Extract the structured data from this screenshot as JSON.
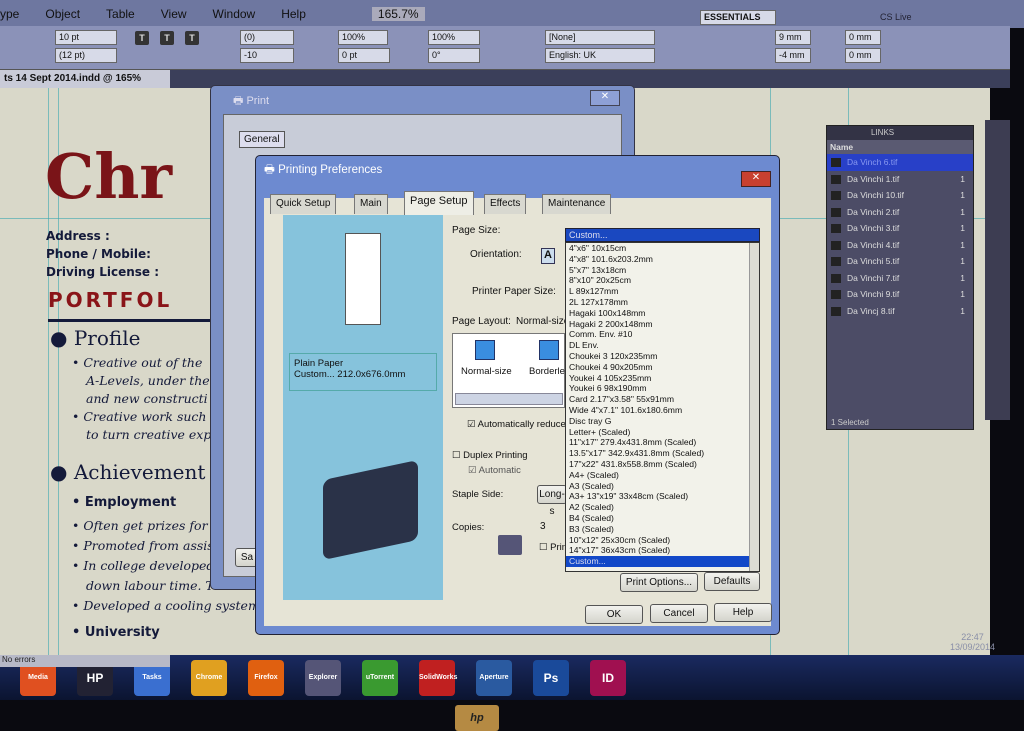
{
  "menu": [
    "ype",
    "Object",
    "Table",
    "View",
    "Window",
    "Help"
  ],
  "zoom": "165.7%",
  "control": {
    "font_size": "10 pt",
    "leading": "(12 pt)",
    "kerning": "(0)",
    "tracking": "-10",
    "vscale": "100%",
    "baseline": "0 pt",
    "hscale": "100%",
    "skew": "0°",
    "char_style": "[None]",
    "language": "English: UK",
    "left_indent": "9 mm",
    "first_indent": "-4 mm",
    "space_before": "0 mm",
    "space_after": "0 mm"
  },
  "workspace": "ESSENTIALS",
  "cs_live": "CS Live",
  "document_tab": "ts 14 Sept 2014.indd @ 165%",
  "doc": {
    "title": "Chr",
    "address": "Address :",
    "phone": "Phone / Mobile:",
    "license": "Driving License :",
    "portfolio": "PORTFOL",
    "profile": "Profile",
    "profile_items": [
      "Creative out of the",
      "A-Levels, under the",
      "and new constructi",
      "Creative work such c",
      "to turn creative expe"
    ],
    "achievements": "Achievement",
    "employment": "Employment",
    "employment_items": [
      "Often get prizes for t",
      "Promoted from assis",
      "In college developed",
      "down labour time. T",
      "Developed a cooling system"
    ],
    "university": "University"
  },
  "status": "No errors",
  "print_dialog": {
    "title": "Print",
    "tab": "General",
    "save_btn": "Sa"
  },
  "prefs": {
    "title": "Printing Preferences",
    "tabs": [
      "Quick Setup",
      "Main",
      "Page Setup",
      "Effects",
      "Maintenance"
    ],
    "active_tab": "Page Setup",
    "media_line1": "Plain Paper",
    "media_line2": "Custom... 212.0x676.0mm",
    "page_size_label": "Page Size:",
    "orientation_label": "Orientation:",
    "printer_paper_label": "Printer Paper Size:",
    "page_layout_label": "Page Layout:",
    "page_layout_value": "Normal-size",
    "layout_options": [
      "Normal-size",
      "Borderless"
    ],
    "auto_reduce": "Automatically reduce",
    "duplex": "Duplex Printing",
    "automatic": "Automatic",
    "staple_label": "Staple Side:",
    "staple_value": "Long-s",
    "copies_label": "Copies:",
    "copies_value": "3",
    "print_check": "Print",
    "page_size_value": "Custom...",
    "page_size_options": [
      "4\"x6\" 10x15cm",
      "4\"x8\" 101.6x203.2mm",
      "5\"x7\" 13x18cm",
      "8\"x10\" 20x25cm",
      "L 89x127mm",
      "2L 127x178mm",
      "Hagaki 100x148mm",
      "Hagaki 2 200x148mm",
      "Comm. Env. #10",
      "DL Env.",
      "Choukei 3 120x235mm",
      "Choukei 4 90x205mm",
      "Youkei 4 105x235mm",
      "Youkei 6 98x190mm",
      "Card 2.17\"x3.58\" 55x91mm",
      "Wide 4\"x7.1\" 101.6x180.6mm",
      "Disc tray G",
      "Letter+ (Scaled)",
      "11\"x17\" 279.4x431.8mm (Scaled)",
      "13.5\"x17\" 342.9x431.8mm (Scaled)",
      "17\"x22\" 431.8x558.8mm (Scaled)",
      "A4+ (Scaled)",
      "A3 (Scaled)",
      "A3+ 13\"x19\" 33x48cm (Scaled)",
      "A2 (Scaled)",
      "B4 (Scaled)",
      "B3 (Scaled)",
      "10\"x12\" 25x30cm (Scaled)",
      "14\"x17\" 36x43cm (Scaled)",
      "Custom..."
    ],
    "print_options_btn": "Print Options...",
    "defaults_btn": "Defaults",
    "ok_btn": "OK",
    "cancel_btn": "Cancel",
    "help_btn": "Help"
  },
  "links": {
    "title": "LINKS",
    "name_header": "Name",
    "items": [
      {
        "name": "Da Vinch 6.tif",
        "n": ""
      },
      {
        "name": "Da Vinchi 1.tif",
        "n": "1"
      },
      {
        "name": "Da Vinchi 10.tif",
        "n": "1"
      },
      {
        "name": "Da Vinchi 2.tif",
        "n": "1"
      },
      {
        "name": "Da Vinchi 3.tif",
        "n": "1"
      },
      {
        "name": "Da Vinchi 4.tif",
        "n": "1"
      },
      {
        "name": "Da Vinchi 5.tif",
        "n": "1"
      },
      {
        "name": "Da Vinchi 7.tif",
        "n": "1"
      },
      {
        "name": "Da Vinchi 9.tif",
        "n": "1"
      },
      {
        "name": "Da Vincj 8.tif",
        "n": "1"
      }
    ],
    "selected": "1 Selected"
  },
  "taskbar": {
    "apps": [
      "Media",
      "HP",
      "Tasks",
      "Chrome",
      "Firefox",
      "Explorer",
      "uTorrent",
      "SolidWorks",
      "Aperture",
      "Ps",
      "ID"
    ],
    "time": "22:47",
    "date": "13/09/2014"
  },
  "bezel_logo": "hp"
}
